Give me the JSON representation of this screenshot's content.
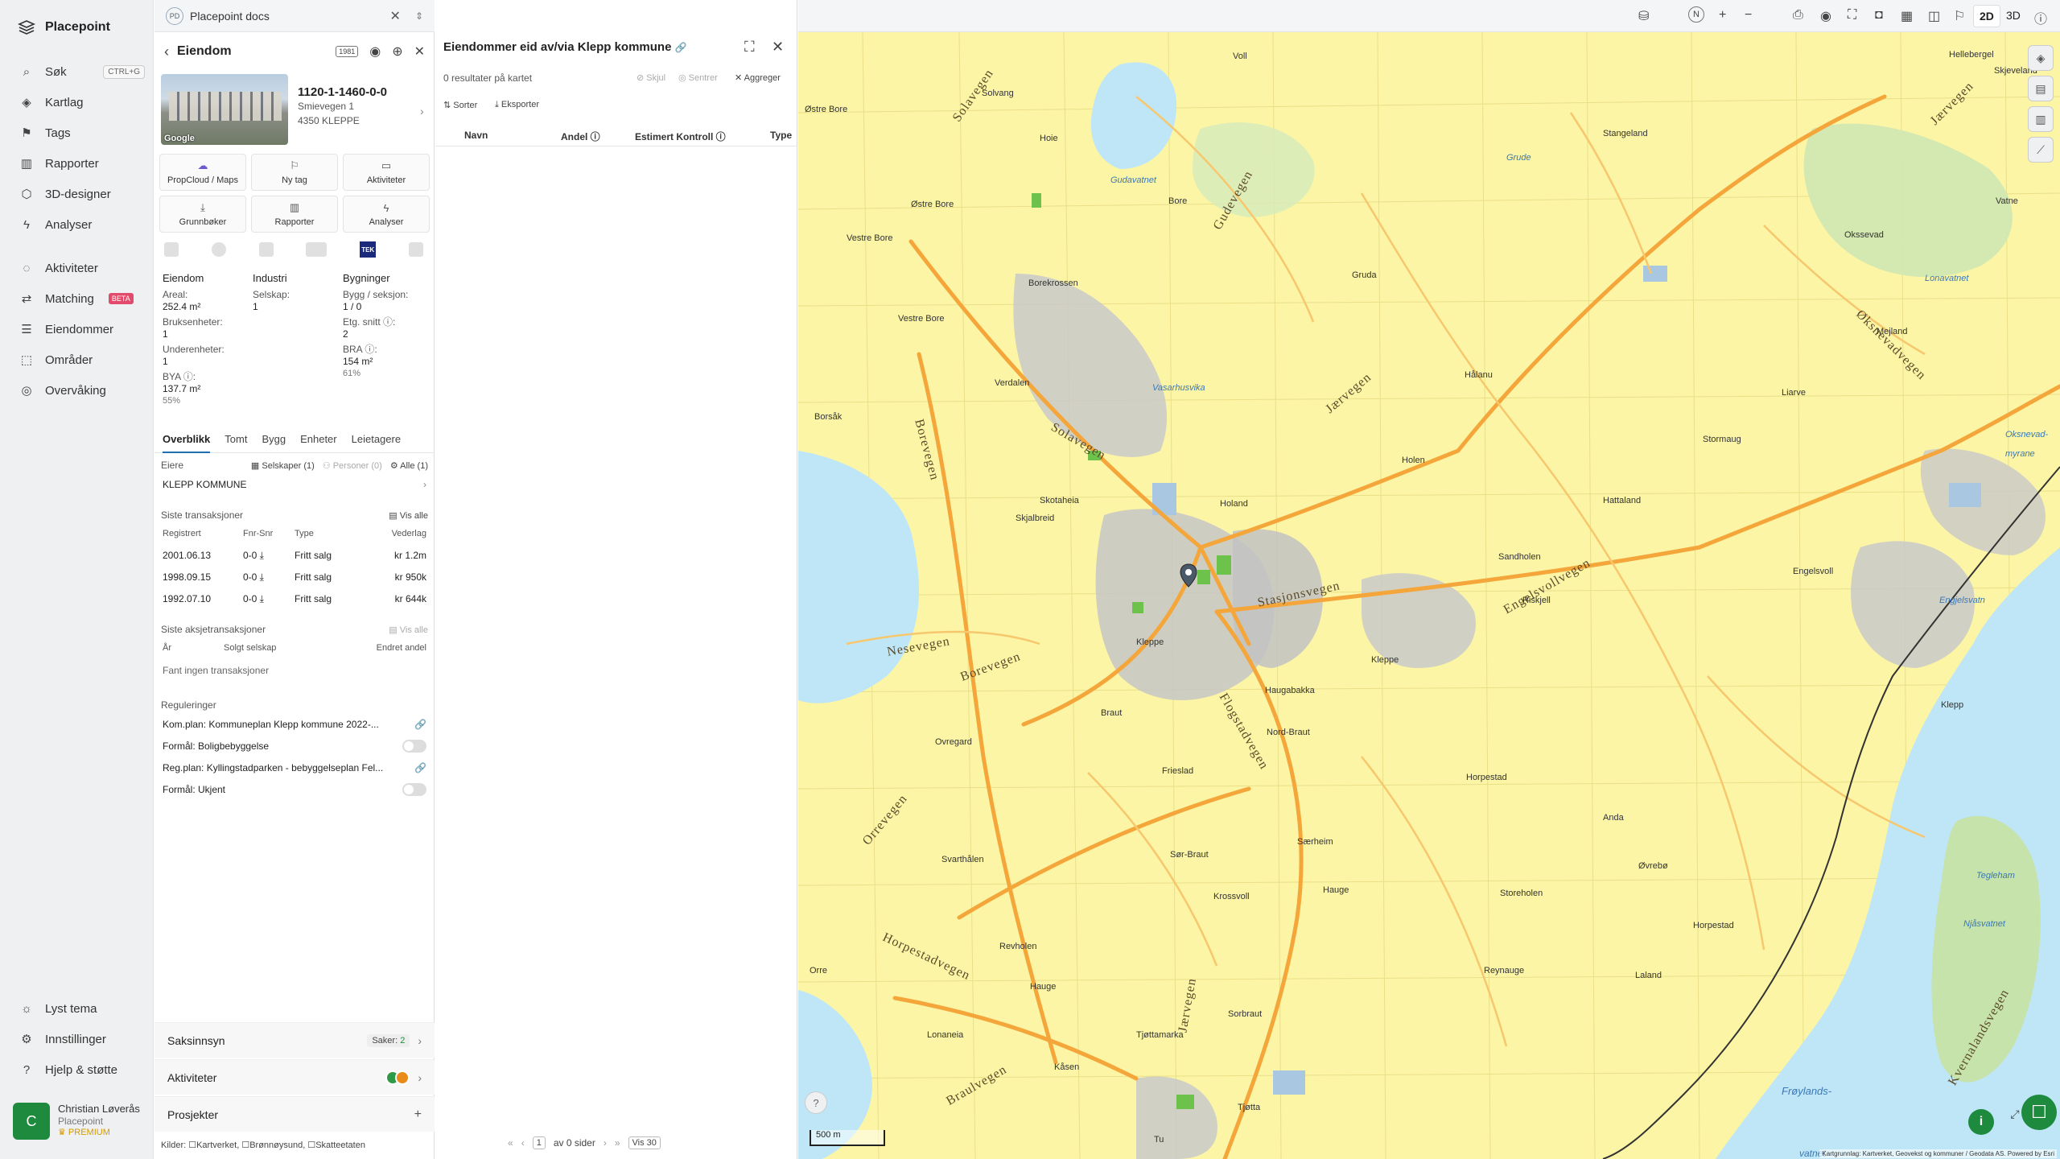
{
  "nav": {
    "brand": "Placepoint",
    "items": [
      {
        "label": "Søk",
        "icon": "search-icon",
        "kbd": "CTRL+G"
      },
      {
        "label": "Kartlag",
        "icon": "layers-icon"
      },
      {
        "label": "Tags",
        "icon": "bookmark-icon"
      },
      {
        "label": "Rapporter",
        "icon": "chart-icon"
      },
      {
        "label": "3D-designer",
        "icon": "cube-icon"
      },
      {
        "label": "Analyser",
        "icon": "bolt-icon"
      },
      {
        "label": "Aktiviteter",
        "icon": "chat-icon"
      },
      {
        "label": "Matching",
        "icon": "handshake-icon",
        "badge": "BETA"
      },
      {
        "label": "Eiendommer",
        "icon": "list-icon"
      },
      {
        "label": "Områder",
        "icon": "area-icon"
      },
      {
        "label": "Overvåking",
        "icon": "radar-icon"
      }
    ],
    "bottom": [
      {
        "label": "Lyst tema",
        "icon": "sun-icon"
      },
      {
        "label": "Innstillinger",
        "icon": "gear-icon"
      },
      {
        "label": "Hjelp & støtte",
        "icon": "help-icon"
      }
    ],
    "user": {
      "initial": "C",
      "name": "Christian Løverås",
      "org": "Placepoint",
      "plan": "PREMIUM"
    }
  },
  "docs": {
    "badge": "PD",
    "title": "Placepoint docs"
  },
  "property": {
    "heading": "Eiendom",
    "year_tag": "1981",
    "id": "1120-1-1460-0-0",
    "street": "Smievegen 1",
    "postal": "4350 KLEPPE",
    "photo_credit": "Google",
    "actions": [
      "PropCloud / Maps",
      "Ny tag",
      "Aktiviteter",
      "Grunnbøker",
      "Rapporter",
      "Analyser"
    ],
    "tek_label": "TEK",
    "facts": {
      "col1": {
        "head": "Eiendom",
        "items": [
          {
            "k": "Areal:",
            "v": "252.4 m²"
          },
          {
            "k": "Bruksenheter:",
            "v": "1"
          },
          {
            "k": "Underenheter:",
            "v": "1"
          },
          {
            "k": "BYA ⓘ:",
            "v": "137.7 m²",
            "p": "55%"
          }
        ]
      },
      "col2": {
        "head": "Industri",
        "items": [
          {
            "k": "Selskap:",
            "v": "1"
          }
        ]
      },
      "col3": {
        "head": "Bygninger",
        "items": [
          {
            "k": "Bygg / seksjon:",
            "v": "1 / 0"
          },
          {
            "k": "Etg. snitt ⓘ:",
            "v": "2"
          },
          {
            "k": "BRA ⓘ:",
            "v": "154 m²",
            "p": "61%"
          }
        ]
      }
    },
    "tabs": [
      "Overblikk",
      "Tomt",
      "Bygg",
      "Enheter",
      "Leietagere"
    ],
    "owners": {
      "label": "Eiere",
      "companies": "Selskaper (1)",
      "persons": "Personer (0)",
      "all": "Alle (1)",
      "owner": "KLEPP KOMMUNE"
    },
    "transactions": {
      "label": "Siste transaksjoner",
      "show_all": "Vis alle",
      "headers": [
        "Registrert",
        "Fnr-Snr",
        "Type",
        "Vederlag"
      ],
      "rows": [
        {
          "date": "2001.06.13",
          "fnr": "0-0 ⤓",
          "type": "Fritt salg",
          "price": "kr 1.2m"
        },
        {
          "date": "1998.09.15",
          "fnr": "0-0 ⤓",
          "type": "Fritt salg",
          "price": "kr 950k"
        },
        {
          "date": "1992.07.10",
          "fnr": "0-0 ⤓",
          "type": "Fritt salg",
          "price": "kr 644k"
        }
      ]
    },
    "stock": {
      "label": "Siste aksjetransaksjoner",
      "show_all": "Vis alle",
      "headers": [
        "År",
        "Solgt selskap",
        "Endret andel"
      ],
      "empty": "Fant ingen transaksjoner"
    },
    "regulations": {
      "label": "Reguleringer",
      "items": [
        {
          "text": "Kom.plan: Kommuneplan Klepp kommune 2022-...",
          "kind": "link"
        },
        {
          "text": "Formål: Boligbebyggelse",
          "kind": "toggle"
        },
        {
          "text": "Reg.plan: Kyllingstadparken - bebyggelseplan Fel...",
          "kind": "link"
        },
        {
          "text": "Formål: Ukjent",
          "kind": "toggle"
        }
      ]
    },
    "bands": {
      "saksinnsyn": "Saksinnsyn",
      "saker_label": "Saker:",
      "saker_count": "2",
      "aktiviteter": "Aktiviteter",
      "prosjekter": "Prosjekter"
    },
    "sources": "Kilder: ☐Kartverket, ☐Brønnøysund, ☐Skatteetaten"
  },
  "owners_panel": {
    "title": "Eiendommer eid av/via Klepp kommune",
    "results": "0 resultater på kartet",
    "hide": "Skjul",
    "center": "Sentrer",
    "aggregate": "Aggreger",
    "sort": "Sorter",
    "export": "Eksporter",
    "columns": [
      "Navn",
      "Andel ⓘ",
      "Estimert Kontroll ⓘ",
      "Type"
    ],
    "pager": {
      "page": "1",
      "of": "av 0 sider",
      "per_page": "Vis 30"
    }
  },
  "map": {
    "view_2d": "2D",
    "view_3d": "3D",
    "scale": "500 m",
    "attribution": "Kartgrunnlag: Kartverket, Geovekst og kommuner / Geodata AS. Powered by Esri",
    "roads": [
      "Solavegen",
      "Borevegen",
      "Nesevegen",
      "Jærvegen",
      "Stasjonsvegen",
      "Engelsvollvegen",
      "Orrevegen",
      "Horpestadvegen",
      "Braulvegen",
      "Flogstadvegen",
      "Gudevegen",
      "Øksnevadvegen",
      "Kvernalandsvegen"
    ],
    "places": [
      "Voll",
      "Solvang",
      "Hoie",
      "Bore",
      "Østre Bore",
      "Vestre Bore",
      "Borekrossen",
      "Østre Bore",
      "Verdalen",
      "Vestre Bore",
      "Borsåk",
      "Skotaheia",
      "Holand",
      "Skjalbreid",
      "Gruda",
      "Hålanu",
      "Holen",
      "Sandholen",
      "Hattaland",
      "Stangeland",
      "Hellebergel",
      "Skjeveland",
      "Okssevad",
      "Mejland",
      "Liarve",
      "Stormaug",
      "Klepp",
      "Kleppe",
      "Riskjell",
      "Engelsvoll",
      "Kleppe",
      "Haugabakka",
      "Nord-Braut",
      "Frieslad",
      "Ovregard",
      "Braut",
      "Særheim",
      "Anda",
      "Horpestad",
      "Svarthålen",
      "Sør-Braut",
      "Hauge",
      "Krossvoll",
      "Storeholen",
      "Revholen",
      "Hauge",
      "Sorbraut",
      "Tjøttamarka",
      "Kåsen",
      "Tjøtta",
      "Tu",
      "Reynauge",
      "Laland",
      "Øvrebø",
      "Horpestad",
      "Orre",
      "Lonaneia",
      "Vatne"
    ],
    "waters": [
      "Vasarhusvika",
      "Gudavatnet",
      "Grude",
      "Lonavatnet",
      "Engjelsvatn",
      "Tegleham",
      "Frøylands-",
      "vatnet",
      "Oksnevad-",
      "myrane",
      "Njåsvatnet"
    ]
  }
}
